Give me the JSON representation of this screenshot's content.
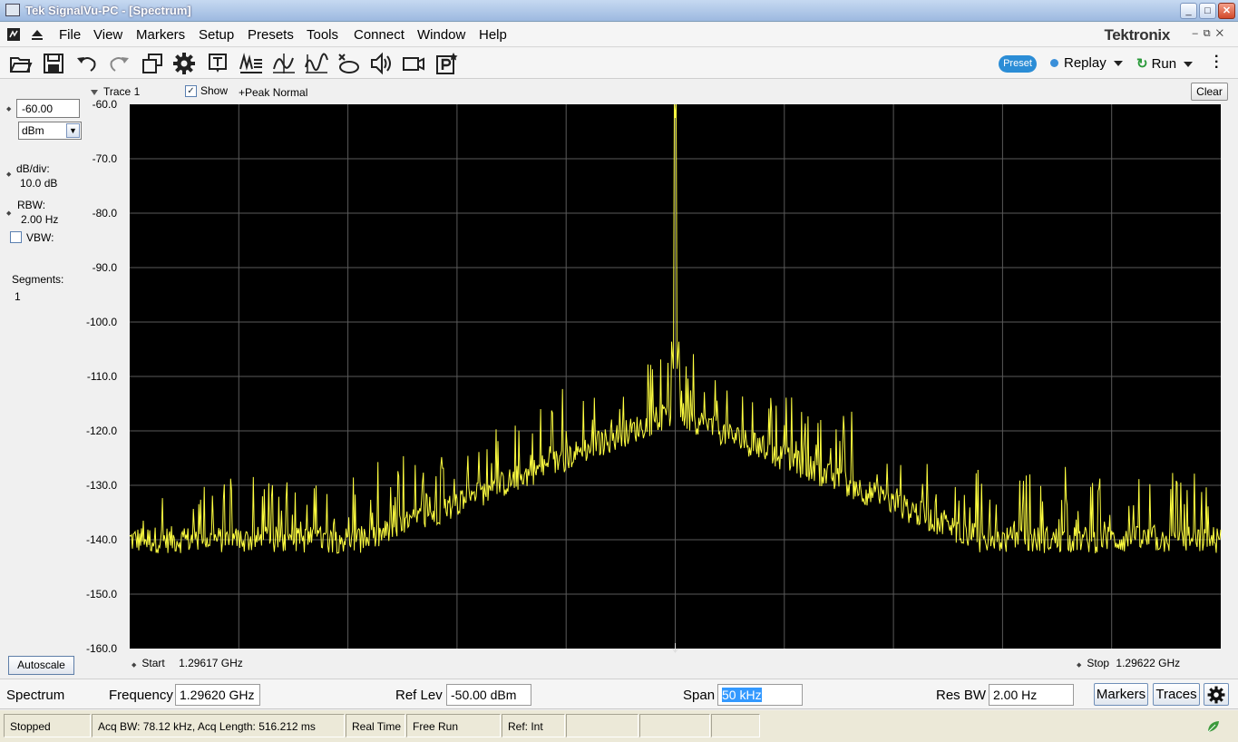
{
  "window": {
    "title": "Tek SignalVu-PC - [Spectrum]",
    "buttons": [
      "_",
      "□",
      "✕"
    ]
  },
  "menu": {
    "items": [
      "File",
      "View",
      "Markers",
      "Setup",
      "Presets",
      "Tools",
      "Connect",
      "Window",
      "Help"
    ],
    "brand": "Tektronix"
  },
  "toolbar": {
    "icons": [
      "open-icon",
      "save-icon",
      "undo-icon",
      "redo-icon",
      "windows-icon",
      "settings-gear-icon",
      "text-tool-icon",
      "acquire-icon",
      "trigger-icon",
      "waveform-icon",
      "replay-data-icon",
      "audio-icon",
      "camera-icon",
      "print-icon"
    ],
    "preset_label": "Preset",
    "replay_label": "Replay",
    "run_label": "Run"
  },
  "trace_bar": {
    "trace_name": "Trace 1",
    "show_label": "Show",
    "show_checked": true,
    "detector": "+Peak Normal",
    "clear_label": "Clear"
  },
  "left_panel": {
    "ref_level_value": "-60.00",
    "unit": "dBm",
    "db_div_label": "dB/div:",
    "db_div_value": "10.0 dB",
    "rbw_label": "RBW:",
    "rbw_value": "2.00 Hz",
    "vbw_label": "VBW:",
    "vbw_checked": false,
    "segments_label": "Segments:",
    "segments_value": "1",
    "autoscale_label": "Autoscale"
  },
  "plot": {
    "y_ticks": [
      "-60.0",
      "-70.0",
      "-80.0",
      "-90.0",
      "-100.0",
      "-110.0",
      "-120.0",
      "-130.0",
      "-140.0",
      "-150.0",
      "-160.0"
    ],
    "start_label": "Start",
    "start_value": "1.29617 GHz",
    "stop_label": "Stop",
    "stop_value": "1.29622 GHz",
    "trace_color": "#ffff40",
    "background": "#000000",
    "grid_color": "#5a5a5a"
  },
  "chart_data": {
    "type": "line",
    "title": "",
    "xlabel": "",
    "ylabel": "",
    "x_range_ghz": [
      1.29617,
      1.29622
    ],
    "ylim": [
      -160,
      -60
    ],
    "y_units": "dBm",
    "peak": {
      "x_ghz": 1.296195,
      "y": -62.5
    },
    "noise_floor_approx": -138,
    "skirt_max_near_peak": -112,
    "grid": true
  },
  "control_bar": {
    "mode": "Spectrum",
    "frequency_label": "Frequency",
    "frequency_value": "1.29620 GHz",
    "ref_lev_label": "Ref Lev",
    "ref_lev_value": "-50.00 dBm",
    "span_label": "Span",
    "span_value": "50 kHz",
    "res_bw_label": "Res BW",
    "res_bw_value": "2.00 Hz",
    "markers_label": "Markers",
    "traces_label": "Traces"
  },
  "status_bar": {
    "state": "Stopped",
    "acq": "Acq BW: 78.12 kHz, Acq Length: 516.212 ms",
    "realtime": "Real Time",
    "trigger": "Free Run",
    "ref": "Ref: Int"
  }
}
